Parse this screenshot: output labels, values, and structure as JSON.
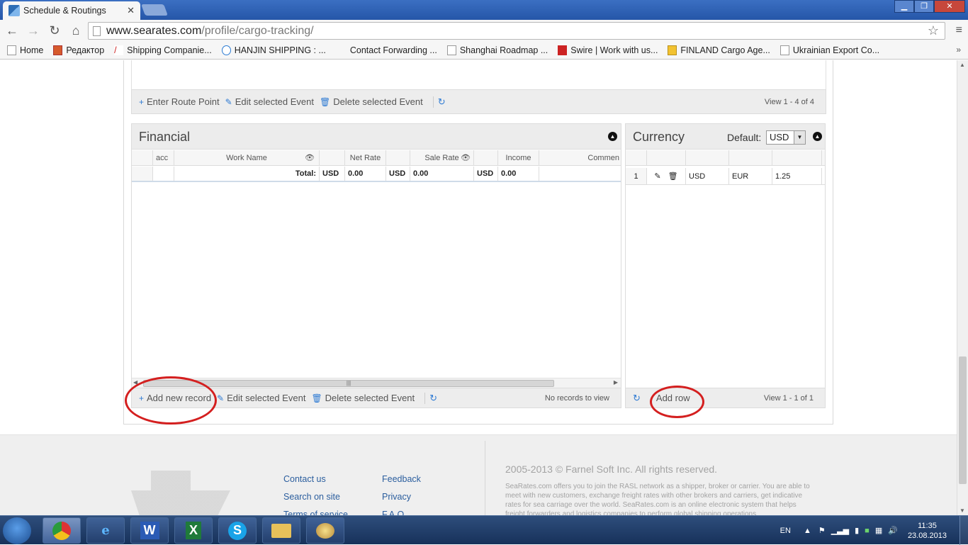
{
  "browser": {
    "tab_title": "Schedule & Routings",
    "url_domain": "www.searates.com",
    "url_path": "/profile/cargo-tracking/",
    "bookmarks": [
      "Home",
      "Редактор",
      "Shipping Companie...",
      "HANJIN SHIPPING : ...",
      "Contact Forwarding ...",
      "Shanghai Roadmap ...",
      "Swire | Work with us...",
      "FINLAND Cargo Age...",
      "Ukrainian Export Co..."
    ]
  },
  "routes": {
    "enter_point": "Enter Route Point",
    "edit": "Edit selected Event",
    "delete": "Delete selected Event",
    "pager": "View 1 - 4 of 4"
  },
  "financial": {
    "title": "Financial",
    "columns": [
      "acc",
      "Work Name",
      "Net Rate",
      "Sale Rate",
      "Income",
      "Commen"
    ],
    "total_label": "Total:",
    "totals": [
      {
        "cur": "USD",
        "val": "0.00"
      },
      {
        "cur": "USD",
        "val": "0.00"
      },
      {
        "cur": "USD",
        "val": "0.00"
      }
    ],
    "add": "Add new record",
    "edit": "Edit selected Event",
    "delete": "Delete selected Event",
    "empty": "No records to view"
  },
  "currency": {
    "title": "Currency",
    "default_label": "Default:",
    "default_value": "USD",
    "rows": [
      {
        "n": "1",
        "from": "USD",
        "to": "EUR",
        "rate": "1.25"
      }
    ],
    "add": "Add row",
    "pager": "View 1 - 1 of 1"
  },
  "footer": {
    "links": [
      "Contact us",
      "Search on site",
      "Terms of service",
      "Feedback",
      "Privacy",
      "F.A.Q."
    ],
    "copyright": "2005-2013 © Farnel Soft Inc. All rights reserved.",
    "description": "SeaRates.com offers you to join the RASL network as a shipper, broker or carrier. You are able to meet with new customers, exchange freight rates with other brokers and carriers, get indicative rates for sea carriage over the world. SeaRates.com is an online electronic system that helps freight forwarders and logistics companies to perform global shipping operations"
  },
  "taskbar": {
    "lang": "EN",
    "time": "11:35",
    "date": "23.08.2013"
  }
}
